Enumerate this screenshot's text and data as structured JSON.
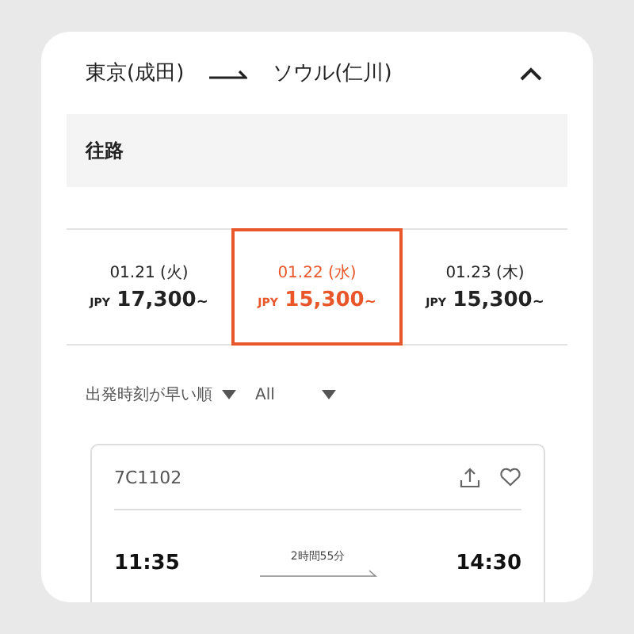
{
  "route": {
    "origin": "東京(成田)",
    "destination": "ソウル(仁川)",
    "expanded": true
  },
  "section": {
    "title": "往路"
  },
  "dates": [
    {
      "date": "01.21 (火)",
      "currency": "JPY",
      "price": "17,300",
      "suffix": "~",
      "selected": false
    },
    {
      "date": "01.22 (水)",
      "currency": "JPY",
      "price": "15,300",
      "suffix": "~",
      "selected": true
    },
    {
      "date": "01.23 (木)",
      "currency": "JPY",
      "price": "15,300",
      "suffix": "~",
      "selected": false
    }
  ],
  "filters": [
    {
      "label": "出発時刻が早い順"
    },
    {
      "label": "All"
    }
  ],
  "flight": {
    "number": "7C1102",
    "departure": "11:35",
    "duration": "2時間55分",
    "arrival": "14:30"
  }
}
